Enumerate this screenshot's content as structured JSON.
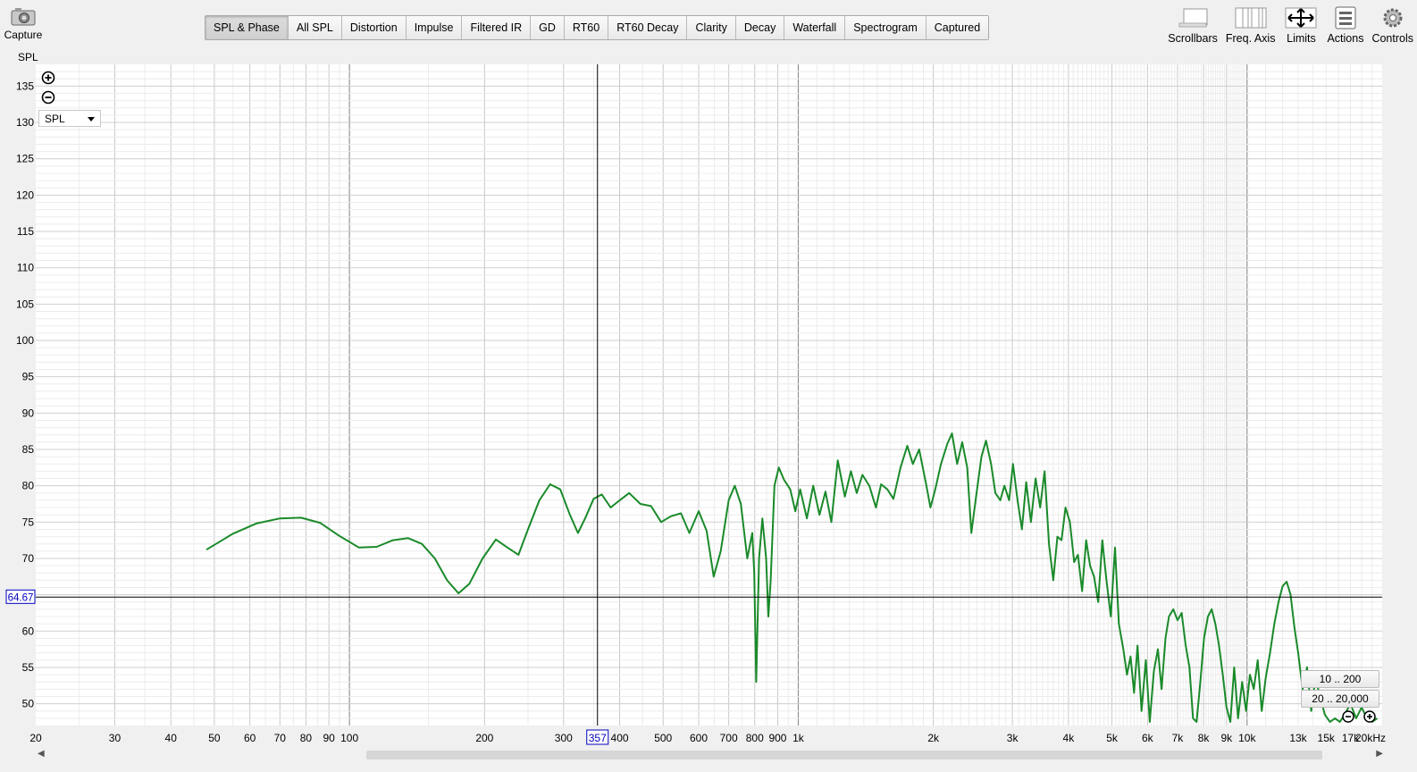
{
  "app": {
    "capture_label": "Capture",
    "left_axis_title": "SPL"
  },
  "tabs": [
    {
      "label": "SPL & Phase",
      "active": true
    },
    {
      "label": "All SPL"
    },
    {
      "label": "Distortion"
    },
    {
      "label": "Impulse"
    },
    {
      "label": "Filtered IR"
    },
    {
      "label": "GD"
    },
    {
      "label": "RT60"
    },
    {
      "label": "RT60 Decay"
    },
    {
      "label": "Clarity"
    },
    {
      "label": "Decay"
    },
    {
      "label": "Waterfall"
    },
    {
      "label": "Spectrogram"
    },
    {
      "label": "Captured"
    }
  ],
  "toolbar": [
    {
      "label": "Scrollbars",
      "icon": "scrollbars-icon"
    },
    {
      "label": "Freq. Axis",
      "icon": "freq-axis-icon"
    },
    {
      "label": "Limits",
      "icon": "limits-icon"
    },
    {
      "label": "Actions",
      "icon": "actions-icon"
    },
    {
      "label": "Controls",
      "icon": "controls-icon"
    }
  ],
  "trace_selector": {
    "value": "SPL"
  },
  "range_buttons": {
    "low": "10 .. 200",
    "full": "20 .. 20,000"
  },
  "colors": {
    "trace": "#1a8a2a",
    "cursor": "#000000",
    "grid_minor": "#dcdcdc",
    "grid_major": "#8a8a8a",
    "readout": "#0000c0"
  },
  "chart_data": {
    "type": "line",
    "x_scale": "log",
    "xlim": [
      20,
      20000
    ],
    "ylim": [
      47,
      138
    ],
    "x_ticks": [
      {
        "v": 20,
        "label": "20"
      },
      {
        "v": 30,
        "label": "30"
      },
      {
        "v": 40,
        "label": "40"
      },
      {
        "v": 50,
        "label": "50"
      },
      {
        "v": 60,
        "label": "60"
      },
      {
        "v": 70,
        "label": "70"
      },
      {
        "v": 80,
        "label": "80"
      },
      {
        "v": 90,
        "label": "90"
      },
      {
        "v": 100,
        "label": "100"
      },
      {
        "v": 200,
        "label": "200"
      },
      {
        "v": 300,
        "label": "300"
      },
      {
        "v": 400,
        "label": "400"
      },
      {
        "v": 500,
        "label": "500"
      },
      {
        "v": 600,
        "label": "600"
      },
      {
        "v": 700,
        "label": "700"
      },
      {
        "v": 800,
        "label": "800"
      },
      {
        "v": 900,
        "label": "900"
      },
      {
        "v": 1000,
        "label": "1k"
      },
      {
        "v": 2000,
        "label": "2k"
      },
      {
        "v": 3000,
        "label": "3k"
      },
      {
        "v": 4000,
        "label": "4k"
      },
      {
        "v": 5000,
        "label": "5k"
      },
      {
        "v": 6000,
        "label": "6k"
      },
      {
        "v": 7000,
        "label": "7k"
      },
      {
        "v": 8000,
        "label": "8k"
      },
      {
        "v": 9000,
        "label": "9k"
      },
      {
        "v": 10000,
        "label": "10k"
      },
      {
        "v": 13000,
        "label": "13k"
      },
      {
        "v": 15000,
        "label": "15k"
      },
      {
        "v": 17000,
        "label": "17k"
      },
      {
        "v": 20000,
        "label": "20kHz"
      }
    ],
    "y_ticks": [
      50,
      55,
      60,
      65,
      70,
      75,
      80,
      85,
      90,
      95,
      100,
      105,
      110,
      115,
      120,
      125,
      130,
      135
    ],
    "cursor": {
      "x": 357,
      "x_label": "357",
      "y": 64.67,
      "y_label": "64.67"
    },
    "series": [
      {
        "points": [
          [
            48,
            71.2
          ],
          [
            55,
            73.4
          ],
          [
            62,
            74.8
          ],
          [
            70,
            75.5
          ],
          [
            78,
            75.6
          ],
          [
            86,
            74.9
          ],
          [
            95,
            73.1
          ],
          [
            105,
            71.5
          ],
          [
            115,
            71.6
          ],
          [
            125,
            72.5
          ],
          [
            135,
            72.8
          ],
          [
            145,
            72.0
          ],
          [
            155,
            70.0
          ],
          [
            165,
            67.0
          ],
          [
            175,
            65.2
          ],
          [
            185,
            66.5
          ],
          [
            198,
            70.0
          ],
          [
            212,
            72.6
          ],
          [
            225,
            71.5
          ],
          [
            238,
            70.5
          ],
          [
            250,
            74.0
          ],
          [
            265,
            78.0
          ],
          [
            280,
            80.2
          ],
          [
            295,
            79.5
          ],
          [
            310,
            76.0
          ],
          [
            323,
            73.5
          ],
          [
            335,
            75.5
          ],
          [
            350,
            78.2
          ],
          [
            365,
            78.8
          ],
          [
            382,
            77.0
          ],
          [
            400,
            78.0
          ],
          [
            420,
            79.0
          ],
          [
            445,
            77.5
          ],
          [
            470,
            77.2
          ],
          [
            495,
            75.0
          ],
          [
            520,
            75.8
          ],
          [
            548,
            76.2
          ],
          [
            572,
            73.5
          ],
          [
            600,
            76.5
          ],
          [
            625,
            73.8
          ],
          [
            648,
            67.5
          ],
          [
            672,
            71.0
          ],
          [
            700,
            78.0
          ],
          [
            722,
            80.0
          ],
          [
            745,
            77.5
          ],
          [
            770,
            70.0
          ],
          [
            790,
            73.5
          ],
          [
            798,
            68.0
          ],
          [
            806,
            53.0
          ],
          [
            818,
            70.0
          ],
          [
            832,
            75.5
          ],
          [
            848,
            70.0
          ],
          [
            858,
            62.0
          ],
          [
            868,
            67.0
          ],
          [
            885,
            80.0
          ],
          [
            905,
            82.5
          ],
          [
            930,
            80.8
          ],
          [
            960,
            79.5
          ],
          [
            985,
            76.5
          ],
          [
            1010,
            79.5
          ],
          [
            1045,
            75.5
          ],
          [
            1080,
            80.0
          ],
          [
            1115,
            76.0
          ],
          [
            1150,
            79.2
          ],
          [
            1185,
            75.0
          ],
          [
            1225,
            83.5
          ],
          [
            1270,
            78.5
          ],
          [
            1310,
            82.0
          ],
          [
            1350,
            79.0
          ],
          [
            1390,
            81.5
          ],
          [
            1440,
            80.0
          ],
          [
            1490,
            77.0
          ],
          [
            1530,
            80.2
          ],
          [
            1580,
            79.5
          ],
          [
            1630,
            78.2
          ],
          [
            1690,
            82.5
          ],
          [
            1750,
            85.5
          ],
          [
            1800,
            83.0
          ],
          [
            1860,
            85.0
          ],
          [
            1930,
            80.0
          ],
          [
            1970,
            77.0
          ],
          [
            2020,
            79.5
          ],
          [
            2080,
            83.0
          ],
          [
            2150,
            85.8
          ],
          [
            2200,
            87.2
          ],
          [
            2260,
            83.0
          ],
          [
            2320,
            86.0
          ],
          [
            2380,
            82.5
          ],
          [
            2430,
            73.5
          ],
          [
            2490,
            78.5
          ],
          [
            2560,
            84.0
          ],
          [
            2620,
            86.2
          ],
          [
            2690,
            83.0
          ],
          [
            2750,
            79.0
          ],
          [
            2820,
            78.0
          ],
          [
            2880,
            80.0
          ],
          [
            2950,
            78.0
          ],
          [
            3010,
            83.0
          ],
          [
            3080,
            78.0
          ],
          [
            3150,
            74.0
          ],
          [
            3220,
            80.5
          ],
          [
            3300,
            75.0
          ],
          [
            3380,
            81.0
          ],
          [
            3460,
            77.0
          ],
          [
            3540,
            82.0
          ],
          [
            3620,
            72.0
          ],
          [
            3700,
            67.0
          ],
          [
            3780,
            73.0
          ],
          [
            3860,
            72.5
          ],
          [
            3940,
            77.0
          ],
          [
            4030,
            75.0
          ],
          [
            4120,
            69.5
          ],
          [
            4200,
            70.5
          ],
          [
            4290,
            65.5
          ],
          [
            4380,
            72.5
          ],
          [
            4470,
            69.0
          ],
          [
            4560,
            67.5
          ],
          [
            4660,
            64.0
          ],
          [
            4760,
            72.5
          ],
          [
            4860,
            67.0
          ],
          [
            4970,
            62.0
          ],
          [
            5080,
            71.5
          ],
          [
            5180,
            61.0
          ],
          [
            5300,
            57.5
          ],
          [
            5400,
            54.0
          ],
          [
            5500,
            56.5
          ],
          [
            5600,
            51.5
          ],
          [
            5700,
            58.0
          ],
          [
            5820,
            49.0
          ],
          [
            5950,
            56.0
          ],
          [
            6070,
            47.5
          ],
          [
            6200,
            54.5
          ],
          [
            6330,
            57.5
          ],
          [
            6450,
            52.0
          ],
          [
            6580,
            59.0
          ],
          [
            6700,
            62.0
          ],
          [
            6850,
            63.0
          ],
          [
            7000,
            61.5
          ],
          [
            7150,
            62.5
          ],
          [
            7300,
            58.0
          ],
          [
            7440,
            55.0
          ],
          [
            7580,
            48.0
          ],
          [
            7720,
            47.5
          ],
          [
            7870,
            53.0
          ],
          [
            8020,
            59.0
          ],
          [
            8180,
            62.0
          ],
          [
            8340,
            63.0
          ],
          [
            8500,
            61.0
          ],
          [
            8660,
            58.0
          ],
          [
            8830,
            54.0
          ],
          [
            9000,
            49.5
          ],
          [
            9180,
            47.5
          ],
          [
            9360,
            55.0
          ],
          [
            9550,
            48.0
          ],
          [
            9750,
            53.0
          ],
          [
            9950,
            49.0
          ],
          [
            10150,
            54.0
          ],
          [
            10350,
            52.0
          ],
          [
            10560,
            56.0
          ],
          [
            10780,
            49.0
          ],
          [
            11000,
            53.5
          ],
          [
            11250,
            57.0
          ],
          [
            11500,
            61.0
          ],
          [
            11750,
            64.0
          ],
          [
            12000,
            66.2
          ],
          [
            12250,
            66.8
          ],
          [
            12500,
            65.0
          ],
          [
            12750,
            60.5
          ],
          [
            13000,
            57.0
          ],
          [
            13300,
            52.0
          ],
          [
            13600,
            55.0
          ],
          [
            13900,
            49.0
          ],
          [
            14200,
            53.5
          ],
          [
            14550,
            51.0
          ],
          [
            14900,
            48.5
          ],
          [
            15300,
            47.5
          ],
          [
            15700,
            48.0
          ],
          [
            16100,
            47.5
          ],
          [
            16500,
            48.5
          ],
          [
            17000,
            50.0
          ],
          [
            17500,
            48.0
          ],
          [
            18000,
            49.5
          ],
          [
            18500,
            48.0
          ],
          [
            19000,
            47.5
          ],
          [
            19500,
            48.0
          ]
        ]
      }
    ]
  }
}
